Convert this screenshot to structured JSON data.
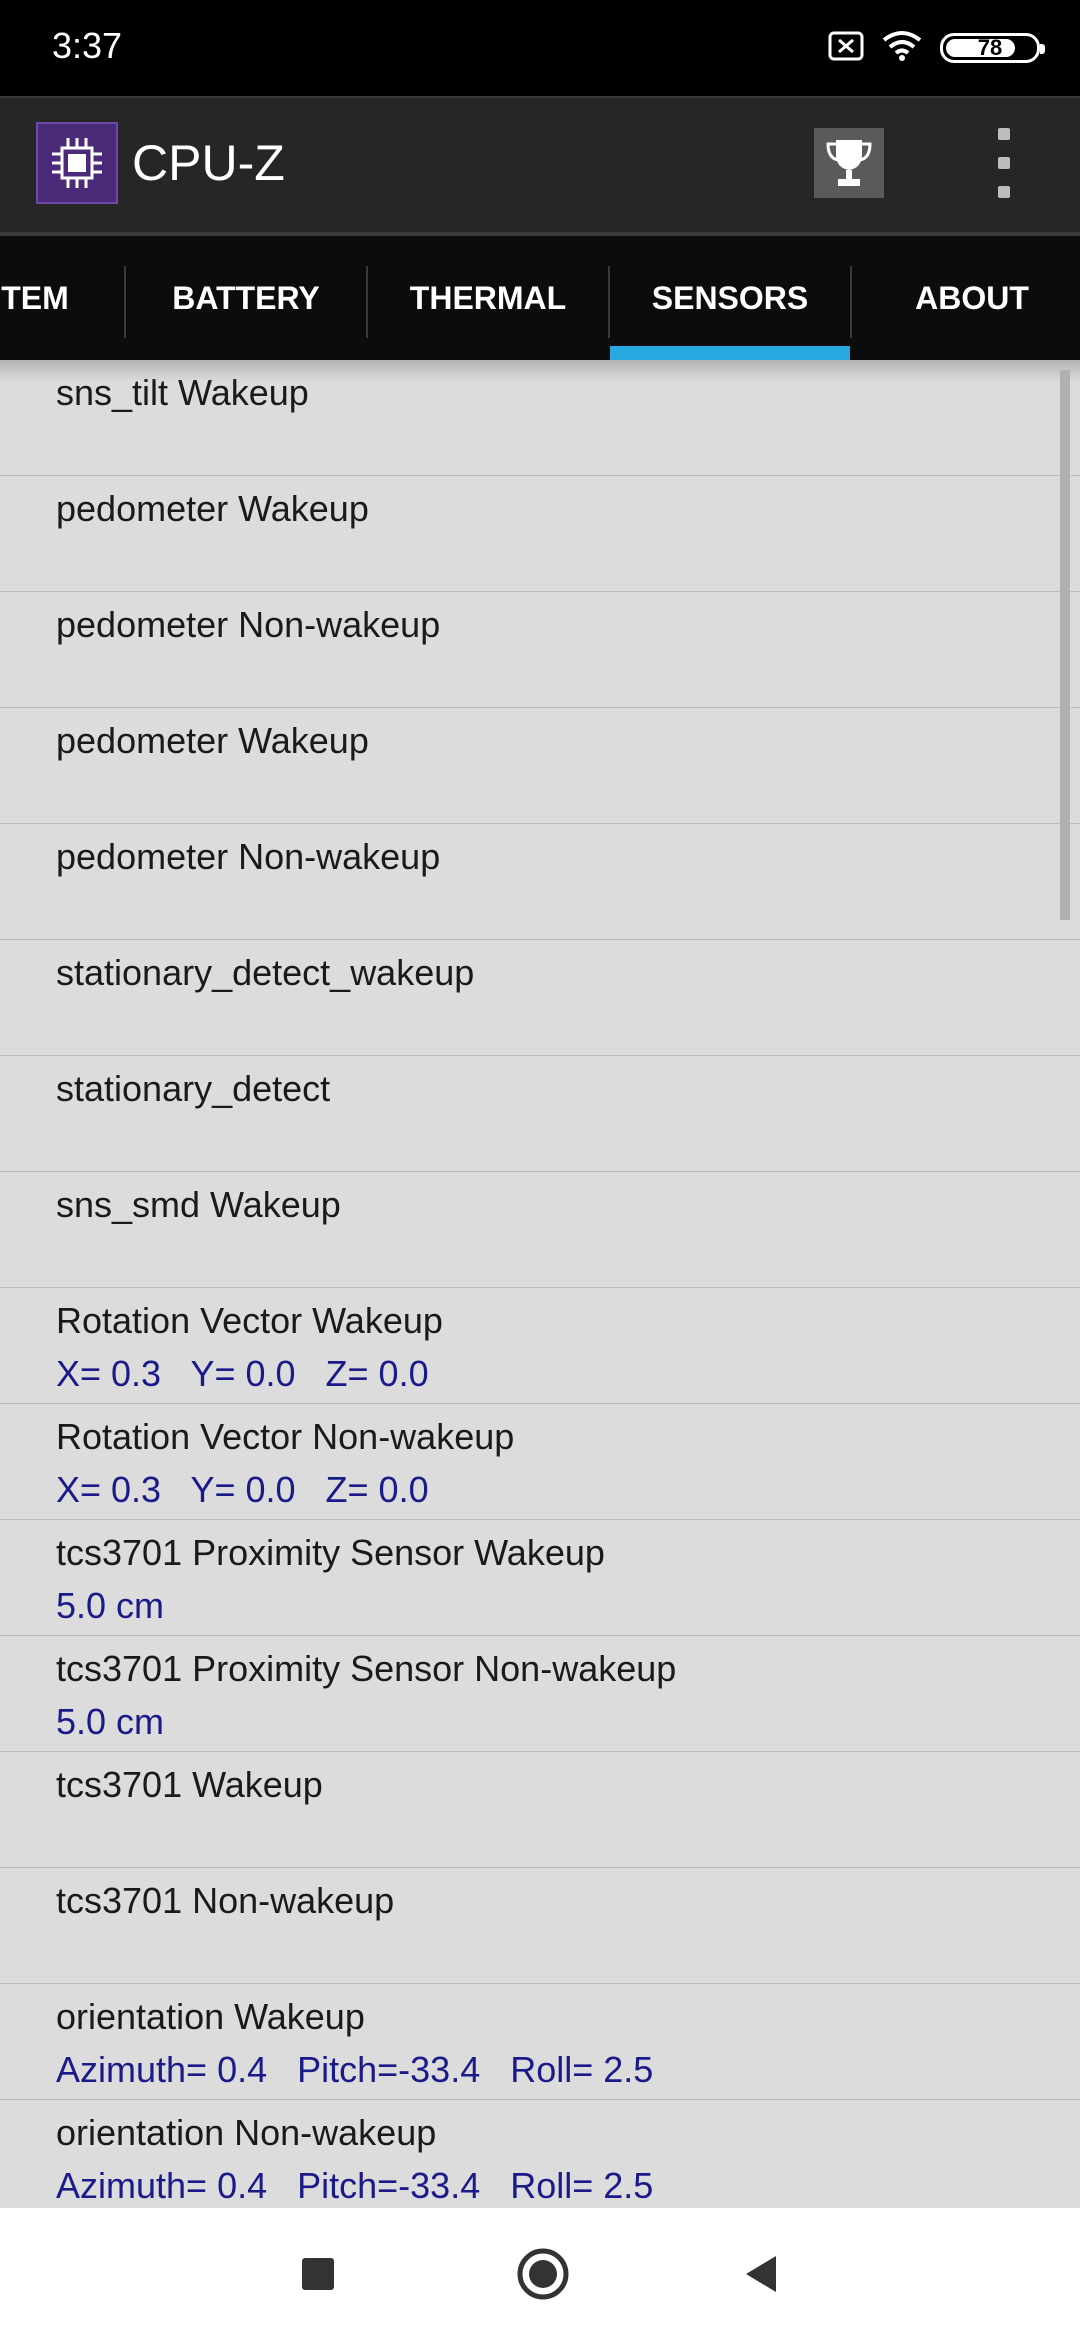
{
  "status_bar": {
    "time": "3:37",
    "battery_level": "78",
    "battery_fraction": 0.78,
    "icons": [
      "sim-off-icon",
      "wifi-icon",
      "battery-icon"
    ]
  },
  "app_bar": {
    "title": "CPU-Z",
    "logo_icon": "cpu-chip-icon",
    "trophy_icon": "trophy-icon",
    "more_icon": "more-vert-icon"
  },
  "tabs": [
    {
      "label": "TEM",
      "selected": false
    },
    {
      "label": "BATTERY",
      "selected": false
    },
    {
      "label": "THERMAL",
      "selected": false
    },
    {
      "label": "SENSORS",
      "selected": true
    },
    {
      "label": "ABOUT",
      "selected": false
    }
  ],
  "sensors": [
    {
      "name": "sns_tilt  Wakeup",
      "value": ""
    },
    {
      "name": "pedometer  Wakeup",
      "value": ""
    },
    {
      "name": "pedometer  Non-wakeup",
      "value": ""
    },
    {
      "name": "pedometer  Wakeup",
      "value": ""
    },
    {
      "name": "pedometer  Non-wakeup",
      "value": ""
    },
    {
      "name": "stationary_detect_wakeup",
      "value": ""
    },
    {
      "name": "stationary_detect",
      "value": ""
    },
    {
      "name": "sns_smd  Wakeup",
      "value": ""
    },
    {
      "name": "Rotation Vector  Wakeup",
      "value": "X= 0.3   Y= 0.0   Z= 0.0"
    },
    {
      "name": "Rotation Vector  Non-wakeup",
      "value": "X= 0.3   Y= 0.0   Z= 0.0"
    },
    {
      "name": "tcs3701 Proximity Sensor Wakeup",
      "value": "5.0 cm"
    },
    {
      "name": "tcs3701 Proximity Sensor Non-wakeup",
      "value": "5.0 cm"
    },
    {
      "name": "tcs3701  Wakeup",
      "value": ""
    },
    {
      "name": "tcs3701  Non-wakeup",
      "value": ""
    },
    {
      "name": "orientation  Wakeup",
      "value": "Azimuth= 0.4   Pitch=-33.4   Roll= 2.5"
    },
    {
      "name": "orientation  Non-wakeup",
      "value": "Azimuth= 0.4   Pitch=-33.4   Roll= 2.5"
    }
  ],
  "nav_bar": {
    "recents_icon": "square-icon",
    "home_icon": "circle-icon",
    "back_icon": "triangle-back-icon"
  },
  "colors": {
    "accent": "#29a8e0",
    "value_text": "#1a1a8a",
    "list_bg": "#dcdcdc",
    "app_bar_bg": "#262626"
  }
}
